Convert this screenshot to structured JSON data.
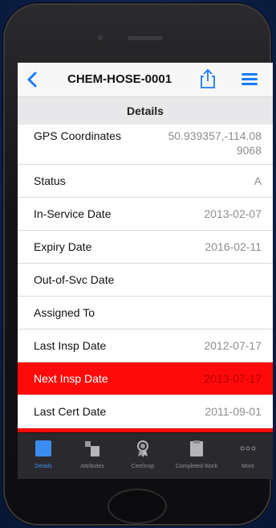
{
  "navbar": {
    "title": "CHEM-HOSE-0001",
    "back_icon": "chevron-left-icon",
    "share_icon": "share-icon",
    "menu_icon": "hamburger-menu-icon",
    "accent_color": "#1a7cf5"
  },
  "section": {
    "title": "Details"
  },
  "rows": [
    {
      "label": "GPS Coordinates",
      "value_line1": "50.939357,-114.08",
      "value_line2": "9068"
    },
    {
      "label": "Status",
      "value": "A"
    },
    {
      "label": "In-Service Date",
      "value": "2013-02-07"
    },
    {
      "label": "Expiry Date",
      "value": "2016-02-11"
    },
    {
      "label": "Out-of-Svc Date",
      "value": ""
    },
    {
      "label": "Assigned To",
      "value": ""
    },
    {
      "label": "Last Insp Date",
      "value": "2012-07-17"
    },
    {
      "label": "Next Insp Date",
      "value": "2013-07-17",
      "highlight_color": "#ff0a0a"
    },
    {
      "label": "Last Cert Date",
      "value": "2011-09-01"
    }
  ],
  "tabs": [
    {
      "label": "Details",
      "icon": "details-square-icon",
      "active": true
    },
    {
      "label": "Attributes",
      "icon": "attributes-blocks-icon",
      "active": false
    },
    {
      "label": "Cert/Insp",
      "icon": "certificate-ribbon-icon",
      "active": false
    },
    {
      "label": "Completed Work",
      "icon": "clipboard-icon",
      "active": false
    },
    {
      "label": "More",
      "icon": "more-dots-icon",
      "active": false
    }
  ]
}
